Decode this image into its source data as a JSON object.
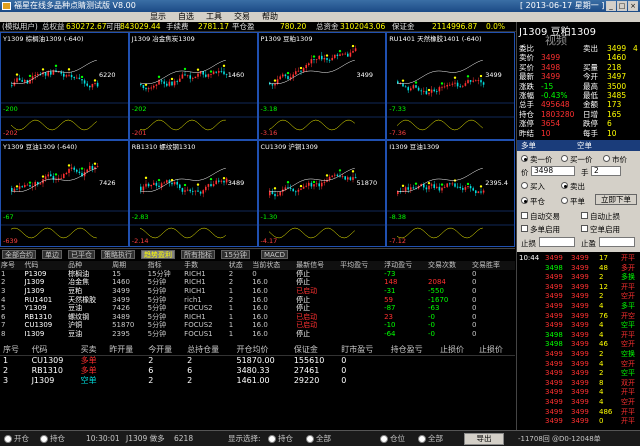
{
  "title": "福星在线多品种点睛测试版 V8.00",
  "date": "[ 2013-06-17 星期一 ]",
  "window_buttons": [
    "_",
    "□",
    "×"
  ],
  "menu": [
    "显示",
    "自选",
    "工具",
    "交易",
    "帮助"
  ],
  "status": {
    "user": "(模拟用户)",
    "equity_label": "总权益",
    "equity": "630272.67",
    "available_label": "可用",
    "available": "843029.44",
    "fee_label": "手续费",
    "fee": "2781.17",
    "float_label": "平仓盈",
    "float": "780.20",
    "deposit_label": "总资金",
    "deposit": "3102043.06",
    "margin_label": "保证金",
    "margin": "2114996.87",
    "risk": "0.0%"
  },
  "charts": [
    {
      "title": "Y1309 棕榈油1309 (-640)",
      "price": "6220",
      "low": "-200",
      "low2": "-202"
    },
    {
      "title": "J1309 冶金焦炭1309",
      "price": "1460",
      "low": "-202",
      "low2": "-201"
    },
    {
      "title": "P1309 豆粕1309",
      "price": "3499",
      "low": "-3.18",
      "low2": "-3.16"
    },
    {
      "title": "RU1401 天然橡胶1401 (-640)",
      "price": "3499",
      "low": "-7.33",
      "low2": "-7.36"
    },
    {
      "title": "Y1309 豆油1309 (-640)",
      "price": "7426",
      "low": "-67",
      "low2": "-639"
    },
    {
      "title": "RB1310 螺纹钢1310",
      "price": "3489",
      "low": "-2.83",
      "low2": "-2.14"
    },
    {
      "title": "CU1309 沪铜1309",
      "price": "51870",
      "low": "-1.30",
      "low2": "-4.17"
    },
    {
      "title": "I1309 豆油1309",
      "price": "2395.4",
      "low": "-8.38",
      "low2": "-7.12"
    }
  ],
  "tabs": [
    "全部合约",
    "单边",
    "已平仓",
    "策略执行",
    "趋势盈利",
    "所有指标",
    "15分钟",
    "MACD"
  ],
  "active_tab": 4,
  "strategy_table": {
    "headers": [
      "序号",
      "代码",
      "品种",
      "周期",
      "指标",
      "手数",
      "状态",
      "当前状态",
      "最新信号",
      "平均盈亏",
      "浮动盈亏",
      "交易次数",
      "交易胜率"
    ],
    "rows": [
      [
        "1",
        "P1309",
        "棕榈油",
        "15",
        "15分钟",
        "RICH1",
        "2",
        "0",
        "停止",
        "",
        "-73",
        "",
        "0"
      ],
      [
        "2",
        "J1309",
        "冶金焦",
        "1460",
        "5分钟",
        "RICH1",
        "2",
        "16.0",
        "停止",
        "",
        "148",
        "2084",
        "0"
      ],
      [
        "3",
        "J1309",
        "豆粕",
        "3499",
        "5分钟",
        "RICH1",
        "1",
        "16.0",
        "已启动",
        "",
        "-31",
        "-550",
        "0"
      ],
      [
        "4",
        "RU1401",
        "天然橡胶",
        "3499",
        "5分钟",
        "rich1",
        "2",
        "16.0",
        "停止",
        "",
        "59",
        "-1670",
        "0"
      ],
      [
        "5",
        "Y1309",
        "豆油",
        "7426",
        "5分钟",
        "FOCUS2",
        "1",
        "16.0",
        "停止",
        "",
        "-87",
        "-63",
        "0"
      ],
      [
        "6",
        "RB1310",
        "螺纹钢",
        "3489",
        "5分钟",
        "RICH1",
        "1",
        "16.0",
        "已启动",
        "",
        "23",
        "-0",
        "0"
      ],
      [
        "7",
        "CU1309",
        "沪铜",
        "51870",
        "5分钟",
        "FOCUS2",
        "1",
        "16.0",
        "已启动",
        "",
        "-10",
        "-0",
        "0"
      ],
      [
        "8",
        "I1309",
        "豆油",
        "2395",
        "5分钟",
        "FOCUS1",
        "1",
        "16.0",
        "停止",
        "",
        "-64",
        "-0",
        "0"
      ]
    ]
  },
  "position_table": {
    "headers": [
      "序号",
      "代码",
      "买卖",
      "昨开量",
      "今开量",
      "总持仓量",
      "开仓均价",
      "保证金",
      "盯市盈亏",
      "持仓盈亏",
      "止损价",
      "止损价"
    ],
    "rows": [
      [
        "1",
        "CU1309",
        "多单",
        "",
        "2",
        "2",
        "51870.00",
        "155610",
        "0",
        "",
        "",
        ""
      ],
      [
        "2",
        "RB1310",
        "多单",
        "",
        "6",
        "6",
        "3480.33",
        "27461",
        "0",
        "",
        "",
        ""
      ],
      [
        "3",
        "J1309",
        "空单",
        "",
        "2",
        "2",
        "1461.00",
        "29220",
        "0",
        "",
        "",
        ""
      ]
    ]
  },
  "quote": {
    "symbol": "J1309 豆粕1309",
    "watermark": "视频",
    "rows": [
      [
        "委比",
        "",
        "卖出",
        "3499",
        "4"
      ],
      [
        "卖价",
        "3499",
        "",
        "1460",
        ""
      ],
      [
        "买价",
        "3498",
        "买量",
        "218",
        ""
      ],
      [
        "最新",
        "3499",
        "今开",
        "3497",
        ""
      ],
      [
        "涨跌",
        "-15",
        "最高",
        "3500",
        ""
      ],
      [
        "涨幅",
        "-0.43%",
        "最低",
        "3485",
        ""
      ],
      [
        "总手",
        "495648",
        "金额",
        "173",
        ""
      ],
      [
        "持仓",
        "1803280",
        "日增",
        "165",
        ""
      ],
      [
        "涨停",
        "3654",
        "跌停",
        "6",
        ""
      ],
      [
        "昨结",
        "10",
        "每手",
        "10",
        ""
      ]
    ]
  },
  "order": {
    "head": "多单",
    "head2": "空单",
    "open_buy": "卖一价",
    "open_sell": "买一价",
    "market": "市价",
    "price_label": "价",
    "price": "3498",
    "qty_label": "手",
    "qty": "2",
    "buy_label": "买入",
    "sell_label": "卖出",
    "open_label": "平仓",
    "close_label": "平单",
    "submit": "立即下单",
    "auto_label": "自动交易",
    "stop_label": "自动止损",
    "multi_label": "多单启用",
    "empty_label": "空单启用",
    "stop_loss": "止损",
    "take_profit": "止盈"
  },
  "ticks": [
    [
      "10:44",
      "3499",
      "3499",
      "17",
      "开平"
    ],
    [
      "",
      "3498",
      "3499",
      "48",
      "多开"
    ],
    [
      "",
      "3499",
      "3499",
      "2",
      "多换"
    ],
    [
      "",
      "3499",
      "3499",
      "12",
      "开平"
    ],
    [
      "",
      "3499",
      "3499",
      "2",
      "空开"
    ],
    [
      "",
      "3499",
      "3499",
      "4",
      "多平"
    ],
    [
      "",
      "3499",
      "3499",
      "76",
      "开空"
    ],
    [
      "",
      "3499",
      "3499",
      "4",
      "空平"
    ],
    [
      "",
      "3498",
      "3499",
      "4",
      "开平"
    ],
    [
      "",
      "3498",
      "3499",
      "46",
      "空开"
    ],
    [
      "",
      "3499",
      "3499",
      "2",
      "空换"
    ],
    [
      "",
      "3499",
      "3499",
      "4",
      "空开"
    ],
    [
      "",
      "3499",
      "3499",
      "2",
      "空平"
    ],
    [
      "",
      "3499",
      "3499",
      "8",
      "双开"
    ],
    [
      "",
      "3499",
      "3499",
      "4",
      "开平"
    ],
    [
      "",
      "3499",
      "3499",
      "4",
      "空开"
    ],
    [
      "",
      "3499",
      "3499",
      "486",
      "开平"
    ],
    [
      "",
      "3499",
      "3499",
      "0",
      "开平"
    ]
  ],
  "bottom": {
    "b1": "开仓",
    "b2": "持仓",
    "time": "10:30:01",
    "q_label": "J1309 做多",
    "q_val": "6218",
    "display_label": "显示选择:",
    "opt1": "持仓",
    "opt2": "全部",
    "opt3": "仓位",
    "opt4": "全部",
    "export": "导出",
    "right": "-11708回 @D0-12048单"
  }
}
